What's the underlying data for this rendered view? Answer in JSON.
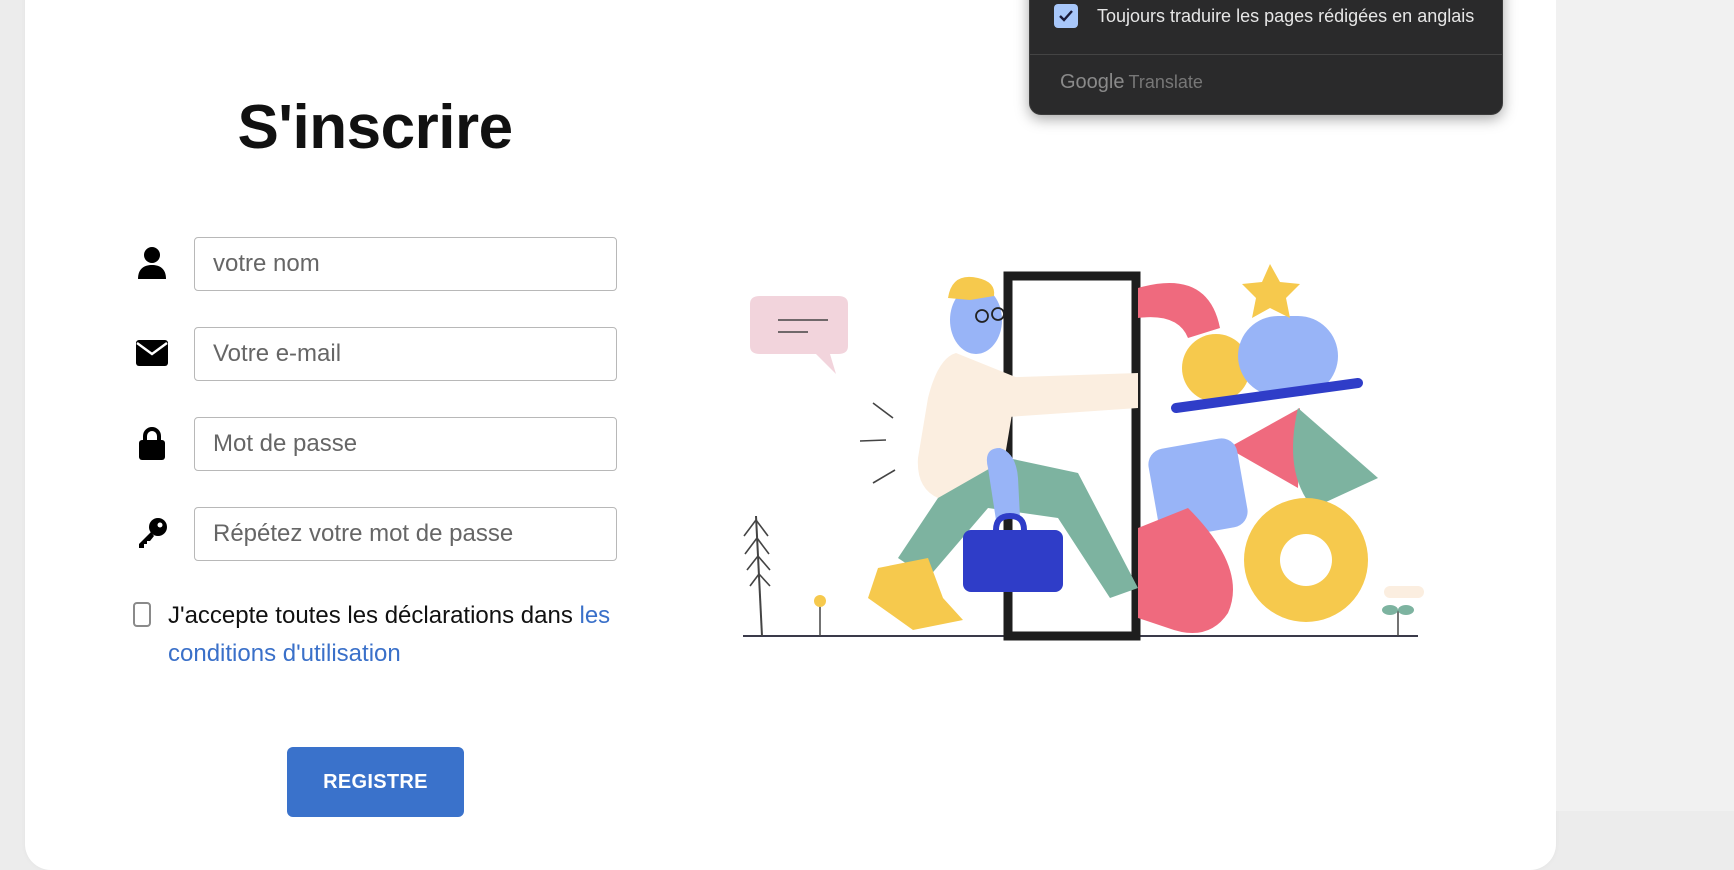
{
  "form": {
    "title": "S'inscrire",
    "fields": [
      {
        "icon": "user-icon",
        "placeholder": "votre nom"
      },
      {
        "icon": "envelope-icon",
        "placeholder": "Votre e-mail"
      },
      {
        "icon": "lock-icon",
        "placeholder": "Mot de passe"
      },
      {
        "icon": "key-icon",
        "placeholder": "Répétez votre mot de passe"
      }
    ],
    "terms": {
      "checked": false,
      "text": "J'accepte toutes les déclarations dans ",
      "link": "les conditions d'utilisation"
    },
    "submit_label": "REGISTRE"
  },
  "translate_popup": {
    "checkbox_checked": true,
    "checkbox_label": "Toujours traduire les pages rédigées en anglais",
    "brand_google": "Google",
    "brand_translate": "Translate"
  },
  "colors": {
    "accent": "#3a72cb",
    "link": "#3a70c9",
    "popup_bg": "#2a2a2b",
    "popup_check": "#a8c7fa"
  }
}
